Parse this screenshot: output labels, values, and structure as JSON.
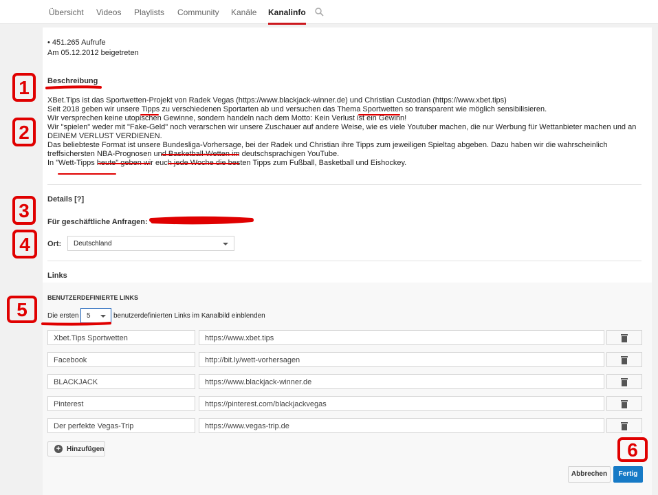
{
  "tabs": [
    "Übersicht",
    "Videos",
    "Playlists",
    "Community",
    "Kanäle",
    "Kanalinfo"
  ],
  "stats": {
    "views": "• 451.265 Aufrufe",
    "joined": "Am 05.12.2012 beigetreten"
  },
  "description": {
    "heading": "Beschreibung",
    "lines": [
      "XBet.Tips ist das Sportwetten-Projekt von Radek Vegas (https://www.blackjack-winner.de) und Christian Custodian (https://www.xbet.tips)",
      "Seit 2018 geben wir unsere Tipps zu verschiedenen Sportarten ab und versuchen das Thema Sportwetten so transparent wie möglich sensibilisieren.",
      "Wir versprechen keine utopischen Gewinne, sondern handeln nach dem Motto: Kein Verlust ist ein Gewinn!",
      "Wir \"spielen\" weder mit \"Fake-Geld\" noch verarschen wir unsere Zuschauer auf andere Weise, wie es viele Youtuber machen, die nur Werbung für Wettanbieter machen und an",
      "DEINEM VERLUST VERDIENEN.",
      "Das beliebteste Format ist unsere Bundesliga-Vorhersage, bei der Radek und Christian ihre Tipps zum jeweiligen Spieltag abgeben. Dazu haben wir die wahrscheinlich",
      "treffsichersten NBA-Prognosen und Basketball-Wetten im deutschsprachigen YouTube.",
      "In \"Wett-Tipps heute\" geben wir euch jede Woche die besten Tipps zum Fußball, Basketball und Eishockey."
    ]
  },
  "details": {
    "heading": "Details [?]",
    "business_label": "Für geschäftliche Anfragen:",
    "location_label": "Ort:",
    "location_value": "Deutschland"
  },
  "links": {
    "heading": "Links",
    "custom_heading": "BENUTZERDEFINIERTE LINKS",
    "show_prefix": "Die ersten",
    "show_count": "5",
    "show_suffix": "benutzerdefinierten Links im Kanalbild einblenden",
    "items": [
      {
        "title": "Xbet.Tips Sportwetten",
        "url": "https://www.xbet.tips"
      },
      {
        "title": "Facebook",
        "url": "http://bit.ly/wett-vorhersagen"
      },
      {
        "title": "BLACKJACK",
        "url": "https://www.blackjack-winner.de"
      },
      {
        "title": "Pinterest",
        "url": "https://pinterest.com/blackjackvegas"
      },
      {
        "title": "Der perfekte Vegas-Trip",
        "url": "https://www.vegas-trip.de"
      }
    ],
    "add_label": "Hinzufügen"
  },
  "buttons": {
    "cancel": "Abbrechen",
    "done": "Fertig"
  },
  "annotations": [
    "1",
    "2",
    "3",
    "4",
    "5",
    "6"
  ],
  "colors": {
    "accent": "#cc181e",
    "primary": "#167ac6",
    "marker": "#e00000"
  }
}
